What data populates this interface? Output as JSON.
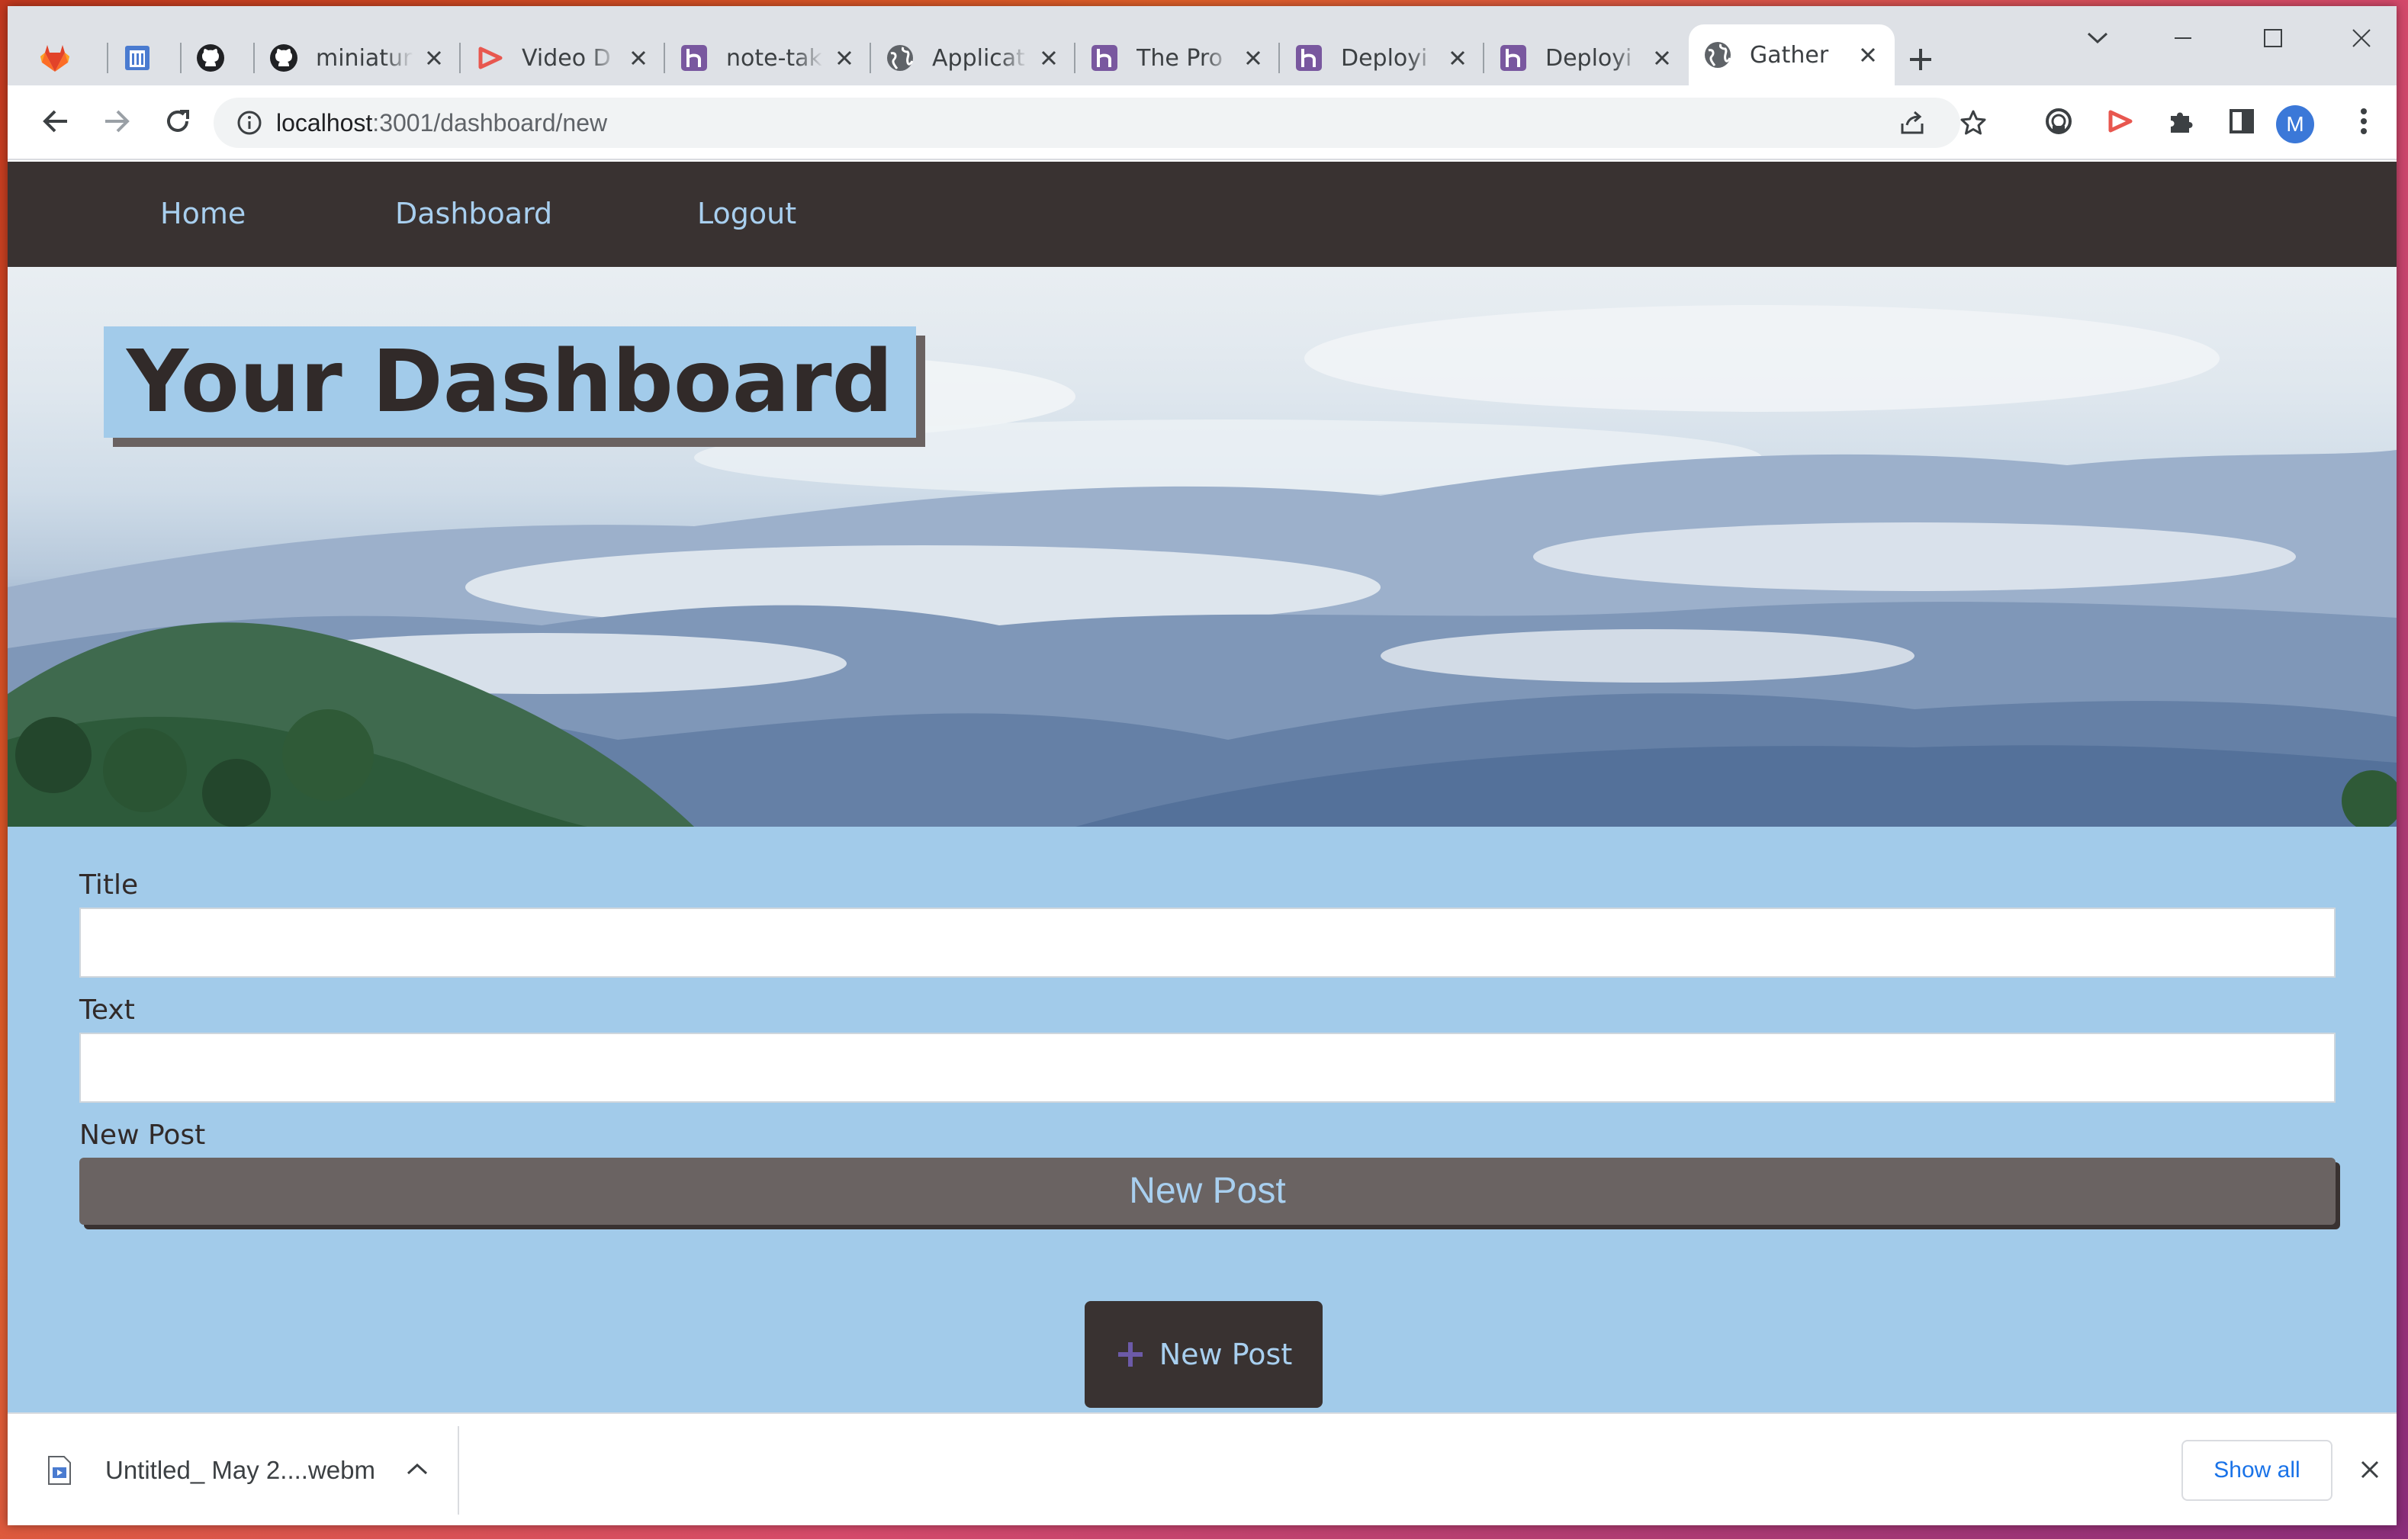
{
  "browser": {
    "tabs": [
      {
        "title": "",
        "icon": "gitlab-icon"
      },
      {
        "title": "",
        "icon": "document-icon"
      },
      {
        "title": "",
        "icon": "github-icon"
      },
      {
        "title": "miniatur",
        "icon": "github-icon"
      },
      {
        "title": "Video D",
        "icon": "video-icon"
      },
      {
        "title": "note-tak",
        "icon": "heroku-icon"
      },
      {
        "title": "Applicat",
        "icon": "globe-icon"
      },
      {
        "title": "The Pro",
        "icon": "heroku-icon"
      },
      {
        "title": "Deployi",
        "icon": "heroku-icon"
      },
      {
        "title": "Deployi",
        "icon": "heroku-icon"
      },
      {
        "title": "Gather",
        "icon": "globe-icon",
        "active": true
      }
    ],
    "address": {
      "host": "localhost",
      "path": ":3001/dashboard/new"
    },
    "profile_initial": "M"
  },
  "nav": {
    "home": "Home",
    "dashboard": "Dashboard",
    "logout": "Logout"
  },
  "hero": {
    "title": "Your Dashboard"
  },
  "form": {
    "title_label": "Title",
    "title_value": "",
    "text_label": "Text",
    "text_value": "",
    "submit_label": "New Post",
    "submit_value": "New Post"
  },
  "new_post_button": {
    "label": "New Post"
  },
  "downloads": {
    "file_name": "Untitled_ May 2....webm",
    "show_all": "Show all"
  },
  "colors": {
    "nav_bg": "#393231",
    "page_bg": "#a2cbea",
    "link": "#a8cfef",
    "submit_bg": "#6a6362"
  }
}
